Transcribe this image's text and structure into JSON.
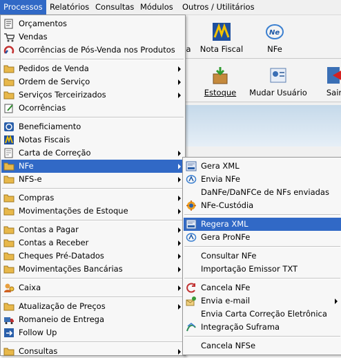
{
  "menubar": {
    "items": [
      {
        "label": "Processos",
        "active": true
      },
      {
        "label": "Relatórios"
      },
      {
        "label": "Consultas"
      },
      {
        "label": "Módulos"
      },
      {
        "label": "Outros / Utilitários"
      }
    ]
  },
  "toolbar": {
    "top_row": {
      "partial_label": "a",
      "nota_fiscal": "Nota Fiscal",
      "nfe": "NFe"
    },
    "bottom_row": {
      "estoque": "Estoque",
      "mudar_usuario": "Mudar Usuário",
      "sair": "Sair"
    }
  },
  "main_menu": {
    "items": [
      {
        "label": "Orçamentos",
        "icon": "orcamentos-icon"
      },
      {
        "label": "Vendas",
        "icon": "vendas-icon"
      },
      {
        "label": "Ocorrências de Pós-Venda nos Produtos",
        "icon": "pos-venda-icon"
      },
      {
        "label": "Pedidos de Venda",
        "icon": "folder-icon",
        "submenu": true
      },
      {
        "label": "Ordem de Serviço",
        "icon": "folder-icon",
        "submenu": true
      },
      {
        "label": "Serviços Terceirizados",
        "icon": "folder-icon",
        "submenu": true
      },
      {
        "label": "Ocorrências",
        "icon": "ocorrencias-icon"
      },
      {
        "label": "Beneficiamento",
        "icon": "beneficiamento-icon"
      },
      {
        "label": "Notas Fiscais",
        "icon": "notas-fiscais-icon"
      },
      {
        "label": "Carta de Correção",
        "icon": "carta-correcao-icon",
        "submenu": true
      },
      {
        "label": "NFe",
        "icon": "folder-icon",
        "submenu": true,
        "selected": true
      },
      {
        "label": "NFS-e",
        "icon": "folder-icon",
        "submenu": true
      },
      {
        "label": "Compras",
        "icon": "folder-icon",
        "submenu": true
      },
      {
        "label": "Movimentações de Estoque",
        "icon": "folder-icon",
        "submenu": true
      },
      {
        "label": "Contas a Pagar",
        "icon": "folder-icon",
        "submenu": true
      },
      {
        "label": "Contas a Receber",
        "icon": "folder-icon",
        "submenu": true
      },
      {
        "label": "Cheques Pré-Datados",
        "icon": "folder-icon",
        "submenu": true
      },
      {
        "label": "Movimentações Bancárias",
        "icon": "folder-icon",
        "submenu": true
      },
      {
        "label": "Caixa",
        "icon": "caixa-icon",
        "submenu": true
      },
      {
        "label": "Atualização de Preços",
        "icon": "folder-icon",
        "submenu": true
      },
      {
        "label": "Romaneio de Entrega",
        "icon": "romaneio-icon"
      },
      {
        "label": "Follow Up",
        "icon": "follow-up-icon"
      },
      {
        "label": "Consultas",
        "icon": "folder-icon",
        "submenu": true
      }
    ]
  },
  "nfe_submenu": {
    "items": [
      {
        "label": "Gera XML",
        "icon": "xml-icon"
      },
      {
        "label": "Envia NFe",
        "icon": "envia-nfe-icon"
      },
      {
        "label": "DaNFe/DaNFCe de NFs enviadas",
        "icon": ""
      },
      {
        "label": "NFe-Custódia",
        "icon": "custodia-icon"
      },
      {
        "label": "Regera XML",
        "icon": "xml-icon",
        "selected": true
      },
      {
        "label": "Gera ProNFe",
        "icon": "envia-nfe-icon"
      },
      {
        "label": "Consultar NFe",
        "icon": ""
      },
      {
        "label": "Importação Emissor TXT",
        "icon": ""
      },
      {
        "label": "Cancela NFe",
        "icon": "cancela-icon"
      },
      {
        "label": "Envia e-mail",
        "icon": "envia-email-icon",
        "submenu": true
      },
      {
        "label": "Envia Carta Correção Eletrônica",
        "icon": ""
      },
      {
        "label": "Integração Suframa",
        "icon": "suframa-icon"
      },
      {
        "label": "Cancela NFSe",
        "icon": ""
      }
    ]
  },
  "colors": {
    "selection": "#3169c6",
    "menu_bg": "#f7f7f7",
    "folder": "#e8b84a"
  }
}
